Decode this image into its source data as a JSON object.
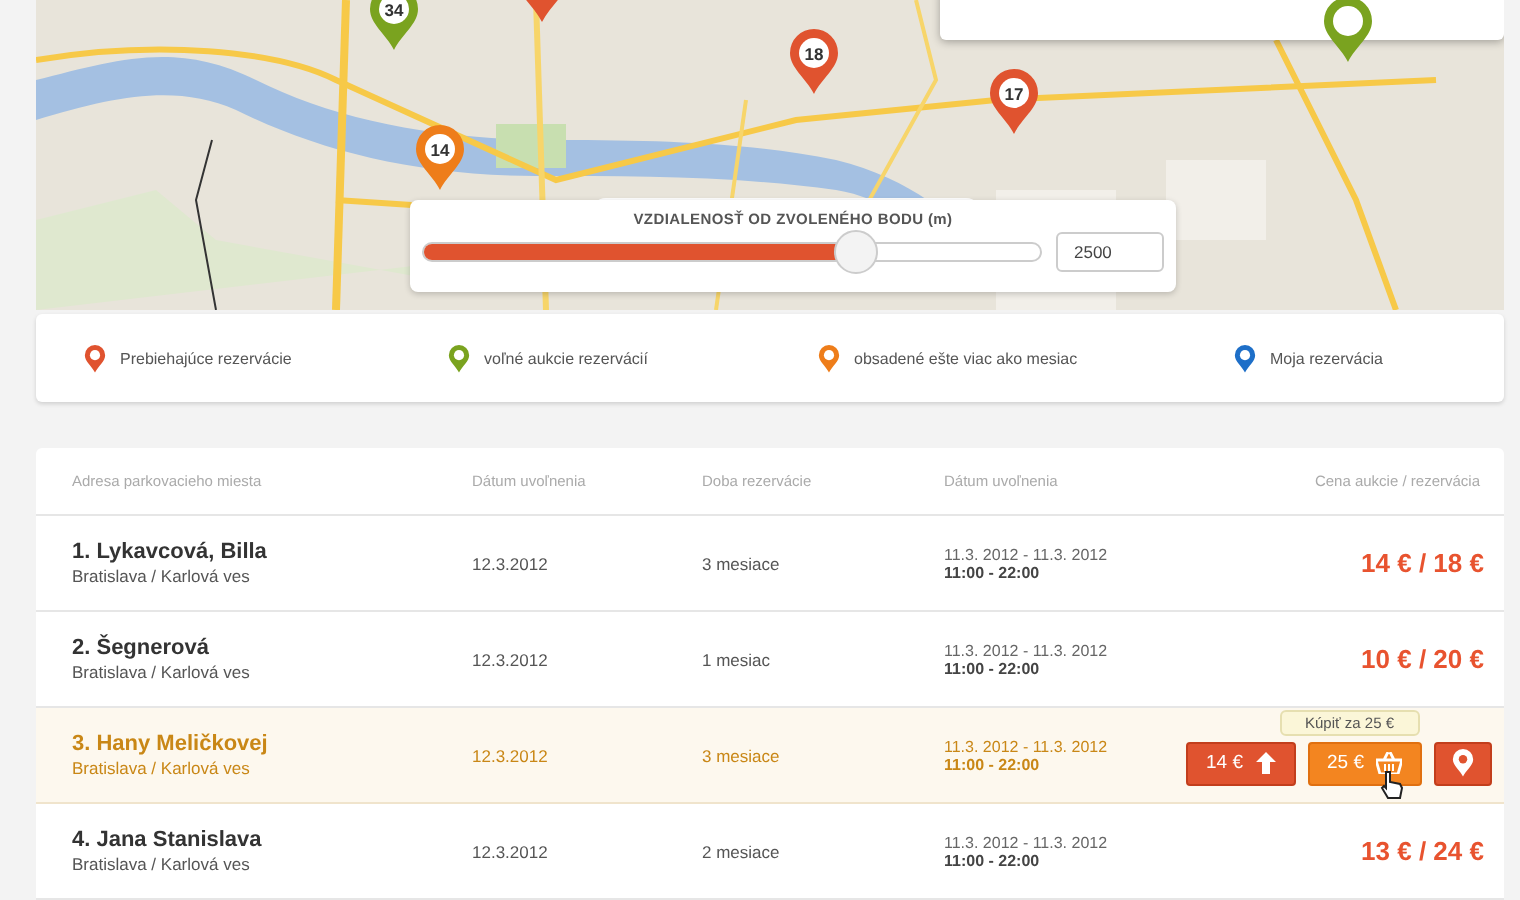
{
  "map": {
    "pins": [
      {
        "label": "34",
        "color": "#7aa31f"
      },
      {
        "color": "#e0532f"
      },
      {
        "label": "18",
        "color": "#e0532f"
      },
      {
        "label": "17",
        "color": "#e0532f"
      },
      {
        "label": "14",
        "color": "#ee7d1a"
      },
      {
        "color": "#7aa31f"
      }
    ],
    "distance": {
      "title": "VZDIALENOSŤ OD ZVOLENÉHO BODU (m)",
      "level": 0.7,
      "value": "2500"
    }
  },
  "legend": [
    {
      "label": "Prebiehajúce rezervácie",
      "color": "#e0532f"
    },
    {
      "label": "voľné aukcie rezervácií",
      "color": "#7aa31f"
    },
    {
      "label": "obsadené ešte viac ako mesiac",
      "color": "#ee7d1a"
    },
    {
      "label": "Moja rezervácia",
      "color": "#1e6fc8"
    }
  ],
  "table": {
    "columns": [
      "Adresa parkovacieho miesta",
      "Dátum uvoľnenia",
      "Doba rezervácie",
      "Dátum uvoľnenia",
      "Cena aukcie / rezervácia"
    ],
    "rows": [
      {
        "name": "1. Lykavcová, Billa",
        "place": "Bratislava / Karlová ves",
        "date": "12.3.2012",
        "duration": "3 mesiace",
        "range": "11.3. 2012 - 11.3. 2012",
        "hours": "11:00 - 22:00",
        "price": "14 € / 18 €",
        "selected": false
      },
      {
        "name": "2. Šegnerová",
        "place": "Bratislava / Karlová ves",
        "date": "12.3.2012",
        "duration": "1 mesiac",
        "range": "11.3. 2012 - 11.3. 2012",
        "hours": "11:00 - 22:00",
        "price": "10 € / 20 €",
        "selected": false
      },
      {
        "name": "3. Hany Meličkovej",
        "place": "Bratislava / Karlová ves",
        "date": "12.3.2012",
        "duration": "3 mesiace",
        "range": "11.3. 2012 - 11.3. 2012",
        "hours": "11:00 - 22:00",
        "selected": true,
        "actions": {
          "bid": "14 €",
          "buy": "25 €",
          "tooltip": "Kúpiť za 25 €"
        }
      },
      {
        "name": "4. Jana Stanislava",
        "place": "Bratislava / Karlová ves",
        "date": "12.3.2012",
        "duration": "2 mesiace",
        "range": "11.3. 2012 - 11.3. 2012",
        "hours": "11:00 - 22:00",
        "price": "13 € / 24 €",
        "selected": false
      }
    ]
  }
}
